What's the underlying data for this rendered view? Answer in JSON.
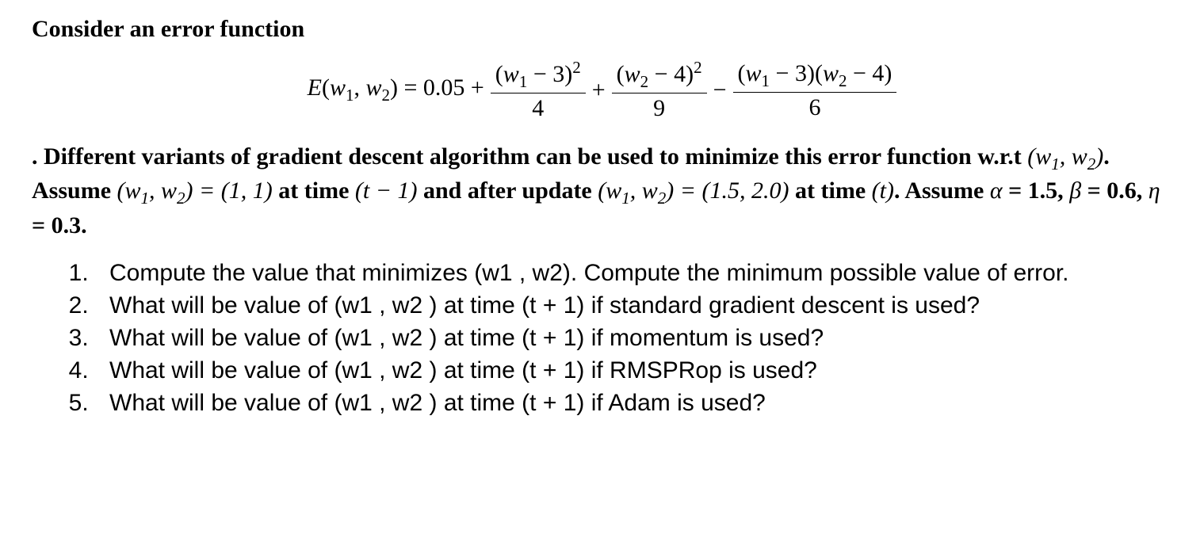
{
  "heading": "Consider an error function",
  "equation": {
    "lhs_E": "E",
    "lhs_open": "(",
    "lhs_w1": "w",
    "lhs_sub1": "1",
    "lhs_comma": ", ",
    "lhs_w2": "w",
    "lhs_sub2": "2",
    "lhs_close": ") = 0.05 +",
    "t1_num_a": "(",
    "t1_num_w": "w",
    "t1_num_sub": "1",
    "t1_num_b": " − 3)",
    "t1_num_sup": "2",
    "t1_den": "4",
    "plus": "+",
    "t2_num_a": "(",
    "t2_num_w": "w",
    "t2_num_sub": "2",
    "t2_num_b": " − 4)",
    "t2_num_sup": "2",
    "t2_den": "9",
    "minus": "−",
    "t3_num_a": "(",
    "t3_num_w1": "w",
    "t3_num_s1": "1",
    "t3_num_b": " − 3)(",
    "t3_num_w2": "w",
    "t3_num_s2": "2",
    "t3_num_c": " − 4)",
    "t3_den": "6"
  },
  "paragraph": {
    "p1a": ".  Different variants of gradient descent algorithm can be used to minimize this error function w.r.t ",
    "p1b_open": "(",
    "p1b_w1": "w",
    "p1b_s1": "1",
    "p1b_comma": ", ",
    "p1b_w2": "w",
    "p1b_s2": "2",
    "p1b_close": ")",
    "p1c": ".  Assume ",
    "p1d_open": "(",
    "p1d_w1": "w",
    "p1d_s1": "1",
    "p1d_comma": ", ",
    "p1d_w2": "w",
    "p1d_s2": "2",
    "p1d_close": ") = (1, 1)",
    "p1e": " at time ",
    "p1f": "(t − 1)",
    "p1g": " and after update ",
    "p1h_open": "(",
    "p1h_w1": "w",
    "p1h_s1": "1",
    "p1h_comma": ", ",
    "p1h_w2": "w",
    "p1h_s2": "2",
    "p1h_close": ") = (1.5, 2.0)",
    "p1i": " at time ",
    "p1j": "(t)",
    "p1k": ".  Assume ",
    "p1l": "α",
    "p1m": " = 1.5, ",
    "p1n": "β",
    "p1o": " = 0.6, ",
    "p1p": "η",
    "p1q": " = 0.3."
  },
  "questions": [
    "Compute the value that minimizes (w1 , w2). Compute the minimum possible value of error.",
    "What will be value of (w1 , w2 ) at time (t + 1) if standard gradient descent is used?",
    "What will be value of (w1 , w2 ) at time (t + 1) if momentum is used?",
    "What will be value of (w1 , w2 ) at time (t + 1) if RMSPRop is used?",
    "What will be value of (w1 , w2 ) at time (t + 1) if Adam is used?"
  ]
}
